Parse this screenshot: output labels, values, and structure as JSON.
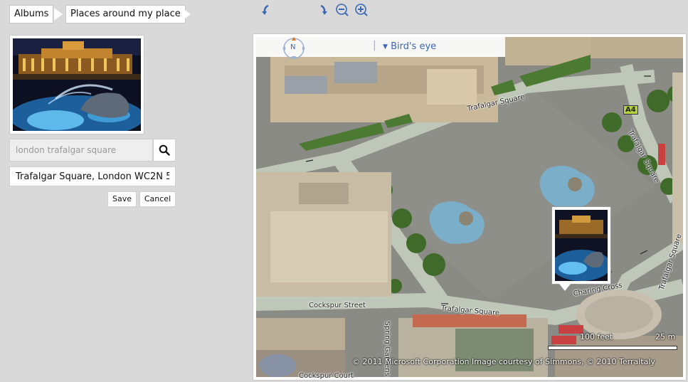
{
  "breadcrumb": {
    "items": [
      {
        "label": "Albums"
      },
      {
        "label": "Places around my place"
      }
    ]
  },
  "photo": {
    "icon": "trafalgar-fountain-night-photo"
  },
  "search": {
    "placeholder": "london trafalgar square",
    "value": "",
    "button_icon": "search-icon"
  },
  "address": {
    "value": "Trafalgar Square, London WC2N 5"
  },
  "actions": {
    "save_label": "Save",
    "cancel_label": "Cancel"
  },
  "map": {
    "view_mode": "Bird's eye",
    "compass_label": "N",
    "tools": [
      "rotate-left-icon",
      "compass-icon",
      "rotate-right-icon",
      "zoom-out-icon",
      "zoom-in-icon"
    ],
    "labels": {
      "trafalgar_square_top": "Trafalgar Square",
      "trafalgar_square_bottom": "Trafalgar Square",
      "trafalgar_square_right": "Trafalgar Square",
      "trafalgar_square_far_right": "Trafalgar Square",
      "cockspur_street": "Cockspur Street",
      "spring_gardens": "Spring Gardens",
      "cockspur_court": "Cockspur Court",
      "charing_cross": "Charing Cross",
      "road_badge": "A4"
    },
    "scale": {
      "feet": "100 feet",
      "meters": "25 m"
    },
    "copyright": "© 2011 Microsoft Corporation   Image courtesy of Simmons, © 2010 Terraltaly"
  },
  "colors": {
    "link_blue": "#3a68b5",
    "compass_orange": "#e07a1f",
    "badge_green": "#b5d33a"
  }
}
